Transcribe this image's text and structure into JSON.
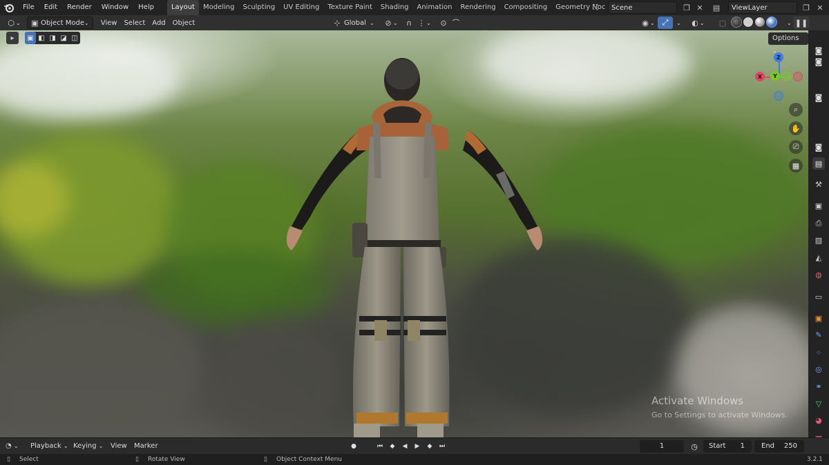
{
  "top_menu": {
    "items": [
      "File",
      "Edit",
      "Render",
      "Window",
      "Help"
    ],
    "workspace_tabs": [
      "Layout",
      "Modeling",
      "Sculpting",
      "UV Editing",
      "Texture Paint",
      "Shading",
      "Animation",
      "Rendering",
      "Compositing",
      "Geometry Noc"
    ],
    "active_tab": "Layout",
    "scene": "Scene",
    "view_layer": "ViewLayer"
  },
  "viewport_header": {
    "mode": "Object Mode",
    "menus": [
      "View",
      "Select",
      "Add",
      "Object"
    ],
    "orientation": "Global",
    "options_label": "Options"
  },
  "gizmo": {
    "axes": [
      {
        "label": "Z",
        "color": "#3d7be6"
      },
      {
        "label": "Y",
        "color": "#7bc62d"
      },
      {
        "label": "X",
        "color": "#e04660"
      }
    ]
  },
  "watermark": {
    "title": "Activate Windows",
    "subtitle": "Go to Settings to activate Windows."
  },
  "timeline": {
    "menus": [
      "Playback",
      "Keying",
      "View",
      "Marker"
    ],
    "current_frame": "1",
    "start_label": "Start",
    "start_value": "1",
    "end_label": "End",
    "end_value": "250"
  },
  "statusbar": {
    "select": "Select",
    "rotate": "Rotate View",
    "context_menu": "Object Context Menu",
    "version": "3.2.1"
  },
  "colors": {
    "accent": "#4772b3",
    "panel": "#303030",
    "topbar": "#232323"
  }
}
